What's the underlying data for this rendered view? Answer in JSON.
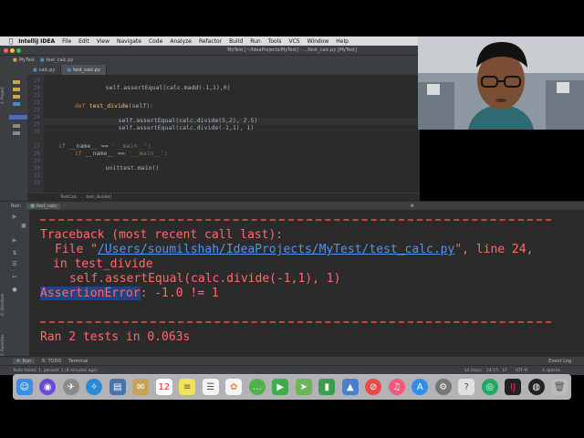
{
  "menubar": {
    "app_name": "IntelliJ IDEA",
    "items": [
      "File",
      "Edit",
      "View",
      "Navigate",
      "Code",
      "Analyze",
      "Refactor",
      "Build",
      "Run",
      "Tools",
      "VCS",
      "Window",
      "Help"
    ]
  },
  "window": {
    "title": "MyTest [~/IdeaProjects/MyTest] - .../test_calc.py [MyTest]"
  },
  "navbar": {
    "project": "MyTest",
    "file": "test_calc.py"
  },
  "editor": {
    "tabs": [
      {
        "label": "calc.py",
        "active": false
      },
      {
        "label": "test_calc.py",
        "active": true
      }
    ],
    "lines": [
      {
        "n": "19"
      },
      {
        "n": "20"
      },
      {
        "n": "21"
      },
      {
        "n": "22"
      },
      {
        "n": "23"
      },
      {
        "n": "24"
      },
      {
        "n": "25"
      },
      {
        "n": "26"
      },
      {
        "n": "27"
      },
      {
        "n": "28"
      },
      {
        "n": "29"
      },
      {
        "n": "30"
      },
      {
        "n": "31"
      },
      {
        "n": "32"
      }
    ],
    "code": {
      "l19": "self.assertEqual(calc.madd(-1,1),0)",
      "l22_kw": "def ",
      "l22_fn": "test_divide",
      "l22_rest": "(self):",
      "l23": "self.assertEqual(calc.divide(5,2), 2.5)",
      "l24": "self.assertEqual(calc.divide(-1,1), 1)",
      "l27_kw": "if ",
      "l27_rest": "__name__ == ",
      "l27_str": "'__main__'",
      "l27_end": ":",
      "l28_kw": "if ",
      "l28_rest": "__name__ == ",
      "l28_str": "'__main__'",
      "l28_end": ":",
      "l29": "unittest.main()"
    },
    "breadcrumb": [
      "TestCalc",
      "test_divide()"
    ]
  },
  "run_panel": {
    "label": "Run:",
    "config": "test_calc",
    "traceback_header": "Traceback (most recent call last):",
    "file_prefix": "File \"",
    "file_path": "/Users/soumilshah/IdeaProjects/MyTest/test_calc.py",
    "file_suffix": "\", line 24,",
    "in_func": "in test_divide",
    "stmt": "self.assertEqual(calc.divide(-1,1), 1)",
    "error_type": "AssertionError",
    "error_msg": ": -1.0 != 1",
    "summary": "Ran 2 tests in 0.063s"
  },
  "bottom_tabs": {
    "run": "4: Run",
    "todo": "6: TODO",
    "terminal": "Terminal",
    "event_log": "Event Log"
  },
  "status": {
    "message": "Tests failed: 1, passed: 1 (8 minutes ago)",
    "chars": "14 chars",
    "pos": "24:15",
    "lf": "LF",
    "encoding": "UTF-8",
    "indent": "4 spaces"
  },
  "side_labels": {
    "project": "1: Project",
    "structure": "Z: Structure",
    "favorites": "2: Favorites"
  },
  "colors": {
    "error": "#ff6b68",
    "link": "#5394ec",
    "selection": "#214283"
  },
  "dock_icons": [
    "finder-icon",
    "siri-icon",
    "launchpad-icon",
    "safari-icon",
    "preview-icon",
    "mail-icon",
    "calendar-icon",
    "notes-icon",
    "reminders-icon",
    "photos-icon",
    "messages-icon",
    "facetime-icon",
    "maps-icon",
    "numbers-icon",
    "keynote-icon",
    "news-icon",
    "music-icon",
    "appstore-icon",
    "system-preferences-icon",
    "chrome-icon",
    "intellij-icon",
    "obs-icon",
    "trash-icon"
  ]
}
